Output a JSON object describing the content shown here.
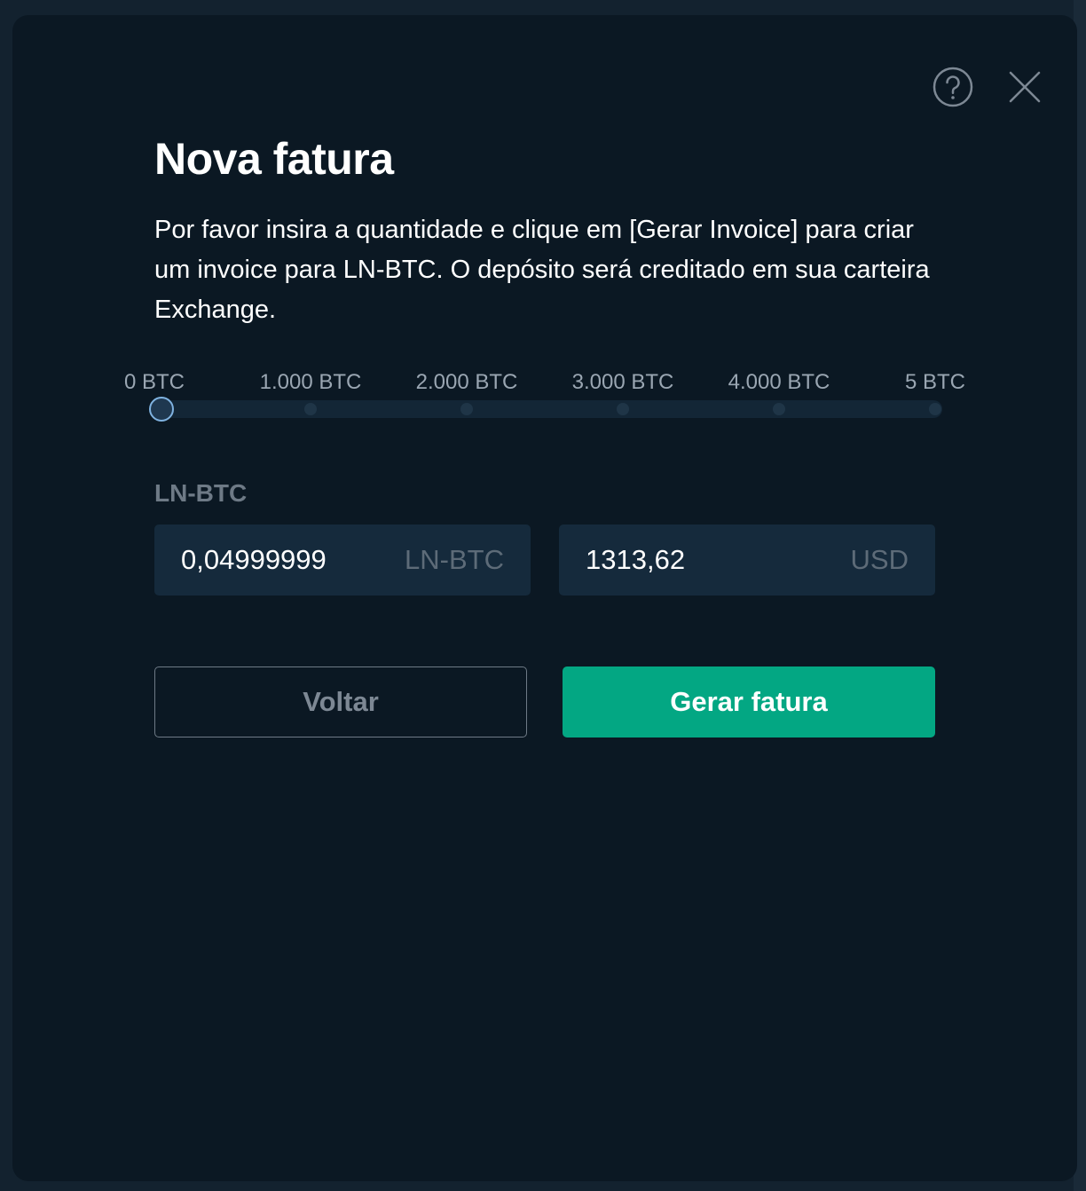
{
  "modal": {
    "title": "Nova fatura",
    "description": "Por favor insira a quantidade e clique em [Gerar Invoice] para criar um invoice para LN-BTC. O depósito será creditado em sua carteira Exchange.",
    "help_icon": "question-circle-icon",
    "close_icon": "close-x-icon"
  },
  "slider": {
    "ticks": [
      "0 BTC",
      "1.000 BTC",
      "2.000 BTC",
      "3.000 BTC",
      "4.000 BTC",
      "5 BTC"
    ],
    "current_fraction": 0
  },
  "form": {
    "label": "LN-BTC",
    "amount": {
      "value": "0,04999999",
      "unit": "LN-BTC"
    },
    "fiat": {
      "value": "1313,62",
      "unit": "USD"
    }
  },
  "actions": {
    "back_label": "Voltar",
    "generate_label": "Gerar fatura"
  },
  "colors": {
    "primary": "#03a783",
    "modal_bg": "#0b1823",
    "input_bg": "#152a3c"
  }
}
